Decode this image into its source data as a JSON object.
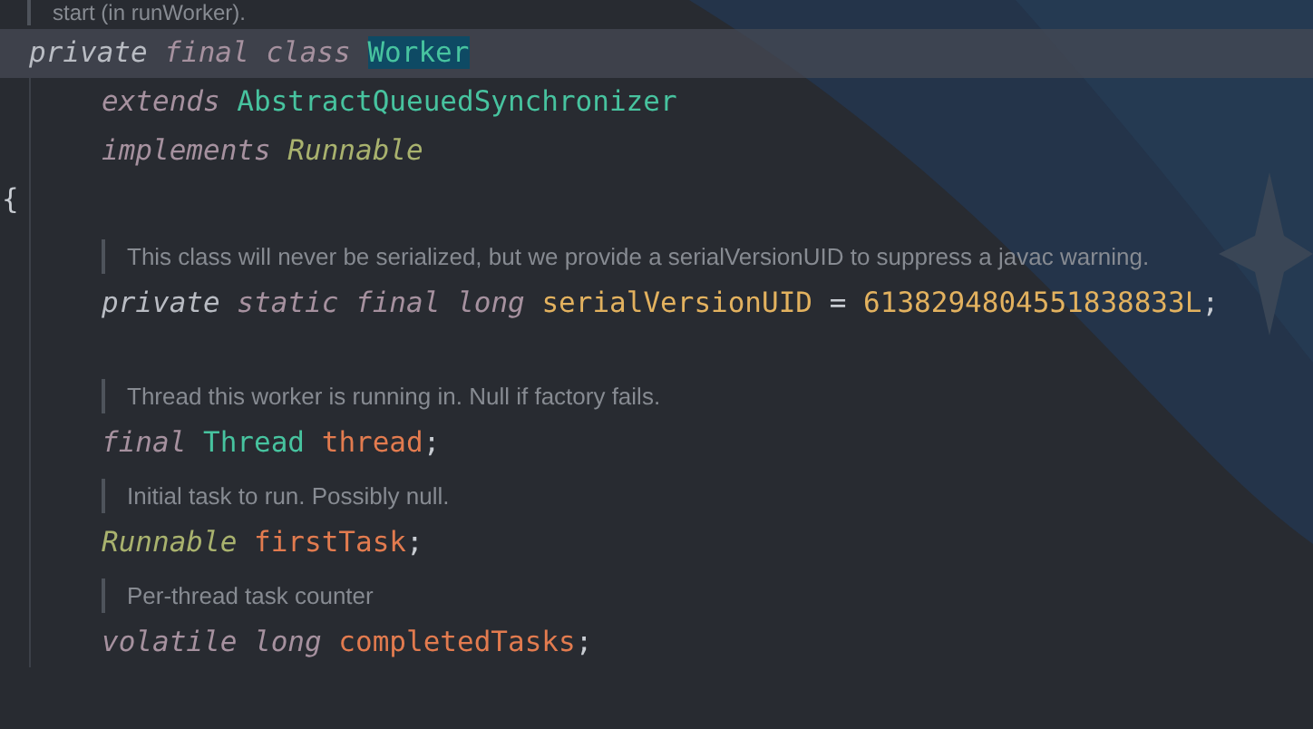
{
  "editor": {
    "class_doc_tail": "start (in runWorker).",
    "class_header": {
      "current": true,
      "tokens": [
        {
          "text": "private",
          "kind": "visibility",
          "highlighted": false
        },
        {
          "text": "final",
          "kind": "keyword",
          "highlighted": false
        },
        {
          "text": "class",
          "kind": "keyword",
          "highlighted": false
        },
        {
          "text": "Worker",
          "kind": "class",
          "highlighted": true
        }
      ]
    },
    "clauses": [
      {
        "tokens": [
          {
            "text": "extends",
            "kind": "keyword"
          },
          {
            "text": "AbstractQueuedSynchronizer",
            "kind": "class"
          }
        ]
      },
      {
        "tokens": [
          {
            "text": "implements",
            "kind": "keyword"
          },
          {
            "text": "Runnable",
            "kind": "interface"
          }
        ]
      }
    ],
    "open_brace": "{",
    "members": [
      {
        "doc": "This class will never be serialized, but we provide a serialVersionUID to suppress a javac warning.",
        "tokens": [
          {
            "text": "private",
            "kind": "visibility"
          },
          {
            "text": "static",
            "kind": "keyword"
          },
          {
            "text": "final",
            "kind": "keyword"
          },
          {
            "text": "long",
            "kind": "keyword"
          },
          {
            "text": "serialVersionUID",
            "kind": "constant"
          },
          {
            "text": "=",
            "kind": "operator"
          },
          {
            "text": "6138294804551838833L",
            "kind": "number"
          },
          {
            "text": ";",
            "kind": "punct"
          }
        ]
      },
      {
        "doc": "Thread this worker is running in. Null if factory fails.",
        "tokens": [
          {
            "text": "final",
            "kind": "keyword"
          },
          {
            "text": "Thread",
            "kind": "class"
          },
          {
            "text": "thread",
            "kind": "field"
          },
          {
            "text": ";",
            "kind": "punct"
          }
        ]
      },
      {
        "doc": "Initial task to run. Possibly null.",
        "tokens": [
          {
            "text": "Runnable",
            "kind": "interface"
          },
          {
            "text": "firstTask",
            "kind": "field"
          },
          {
            "text": ";",
            "kind": "punct"
          }
        ]
      },
      {
        "doc": "Per-thread task counter",
        "tokens": [
          {
            "text": "volatile",
            "kind": "keyword"
          },
          {
            "text": "long",
            "kind": "keyword"
          },
          {
            "text": "completedTasks",
            "kind": "field"
          },
          {
            "text": ";",
            "kind": "punct"
          }
        ]
      }
    ]
  }
}
